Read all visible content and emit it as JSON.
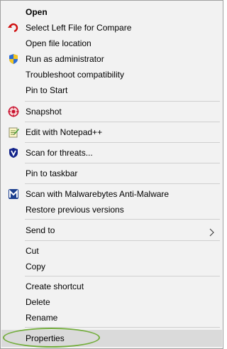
{
  "menu": {
    "items": {
      "open": "Open",
      "select_left": "Select Left File for Compare",
      "open_location": "Open file location",
      "run_admin": "Run as administrator",
      "troubleshoot": "Troubleshoot compatibility",
      "pin_start": "Pin to Start",
      "snapshot": "Snapshot",
      "notepad": "Edit with Notepad++",
      "scan_threats": "Scan for threats...",
      "pin_taskbar": "Pin to taskbar",
      "malwarebytes": "Scan with Malwarebytes Anti-Malware",
      "restore": "Restore previous versions",
      "send_to": "Send to",
      "cut": "Cut",
      "copy": "Copy",
      "create_shortcut": "Create shortcut",
      "delete": "Delete",
      "rename": "Rename",
      "properties": "Properties"
    },
    "icons": {
      "select_left": "undo-arrow-icon",
      "run_admin": "uac-shield-icon",
      "snapshot": "snapshot-target-icon",
      "notepad": "notepad-plus-plus-icon",
      "scan_threats": "antivirus-shield-icon",
      "malwarebytes": "malwarebytes-icon",
      "send_to": "chevron-right-icon"
    },
    "highlighted_item": "Properties",
    "colors": {
      "menu_background": "#f2f2f2",
      "highlight": "#dadada",
      "annotation_ring": "#73ad3c"
    }
  }
}
